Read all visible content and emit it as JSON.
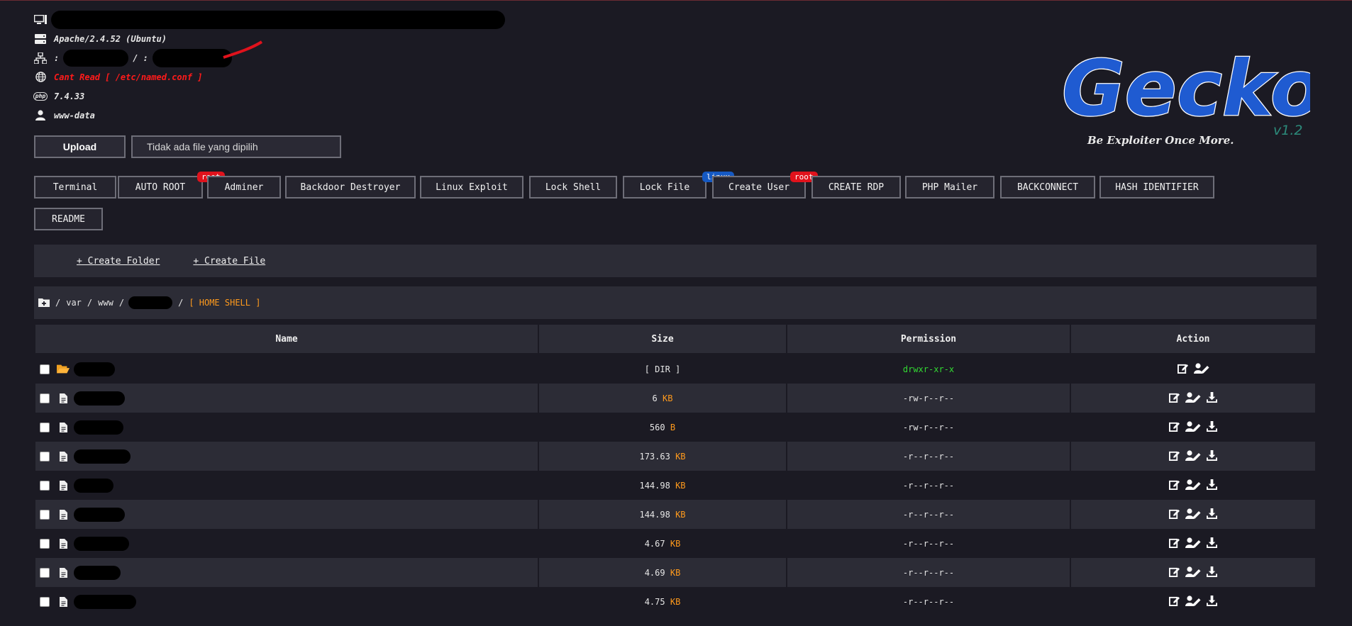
{
  "server_info": {
    "hostname": "",
    "server_software": "Apache/2.4.52 (Ubuntu)",
    "ip_prefix": ":",
    "ip_separator": "/ :",
    "domains": "Cant Read [ /etc/named.conf ]",
    "php_version": "7.4.33",
    "user": "www-data"
  },
  "upload": {
    "button_label": "Upload",
    "file_placeholder": "Tidak ada file yang dipilih"
  },
  "tools": [
    {
      "label": "Terminal"
    },
    {
      "label": "AUTO ROOT",
      "badge": "root"
    },
    {
      "label": "Adminer"
    },
    {
      "label": "Backdoor Destroyer"
    },
    {
      "label": "Linux Exploit"
    },
    {
      "label": "Lock Shell"
    },
    {
      "label": "Lock File",
      "badge": "linux"
    },
    {
      "label": "Create User",
      "badge": "root"
    },
    {
      "label": "CREATE RDP"
    },
    {
      "label": "PHP Mailer"
    },
    {
      "label": "BACKCONNECT"
    },
    {
      "label": "HASH IDENTIFIER"
    },
    {
      "label": "README"
    }
  ],
  "logo": {
    "text": "Gecko",
    "tagline": "Be Exploiter Once More.",
    "version": "v1.2"
  },
  "actions_bar": {
    "create_folder": "+ Create Folder",
    "create_file": "+ Create File"
  },
  "path": {
    "sep1": "/",
    "part1": "var",
    "sep2": "/",
    "part2": "www",
    "sep3": "/",
    "sep4": "/",
    "home_shell": "[ HOME SHELL ]"
  },
  "table": {
    "headers": {
      "name": "Name",
      "size": "Size",
      "permission": "Permission",
      "action": "Action"
    },
    "rows": [
      {
        "type": "dir",
        "size": "[ DIR ]",
        "unit": "",
        "perm": "drwxr-xr-x"
      },
      {
        "type": "file",
        "size": "6",
        "unit": "KB",
        "perm": "-rw-r--r--"
      },
      {
        "type": "file",
        "size": "560",
        "unit": "B",
        "perm": "-rw-r--r--"
      },
      {
        "type": "file",
        "size": "173.63",
        "unit": "KB",
        "perm": "-r--r--r--"
      },
      {
        "type": "file",
        "size": "144.98",
        "unit": "KB",
        "perm": "-r--r--r--"
      },
      {
        "type": "file",
        "size": "144.98",
        "unit": "KB",
        "perm": "-r--r--r--"
      },
      {
        "type": "file",
        "size": "4.67",
        "unit": "KB",
        "perm": "-r--r--r--"
      },
      {
        "type": "file",
        "size": "4.69",
        "unit": "KB",
        "perm": "-r--r--r--"
      },
      {
        "type": "file",
        "size": "4.75",
        "unit": "KB",
        "perm": "-r--r--r--"
      }
    ]
  },
  "colors": {
    "background": "#1b1a23",
    "panel": "#2c2c36",
    "accent_orange": "#ff9a1c",
    "error_red": "#ff1a1a",
    "perm_green": "#33d933",
    "logo_blue": "#1f5bd1"
  }
}
